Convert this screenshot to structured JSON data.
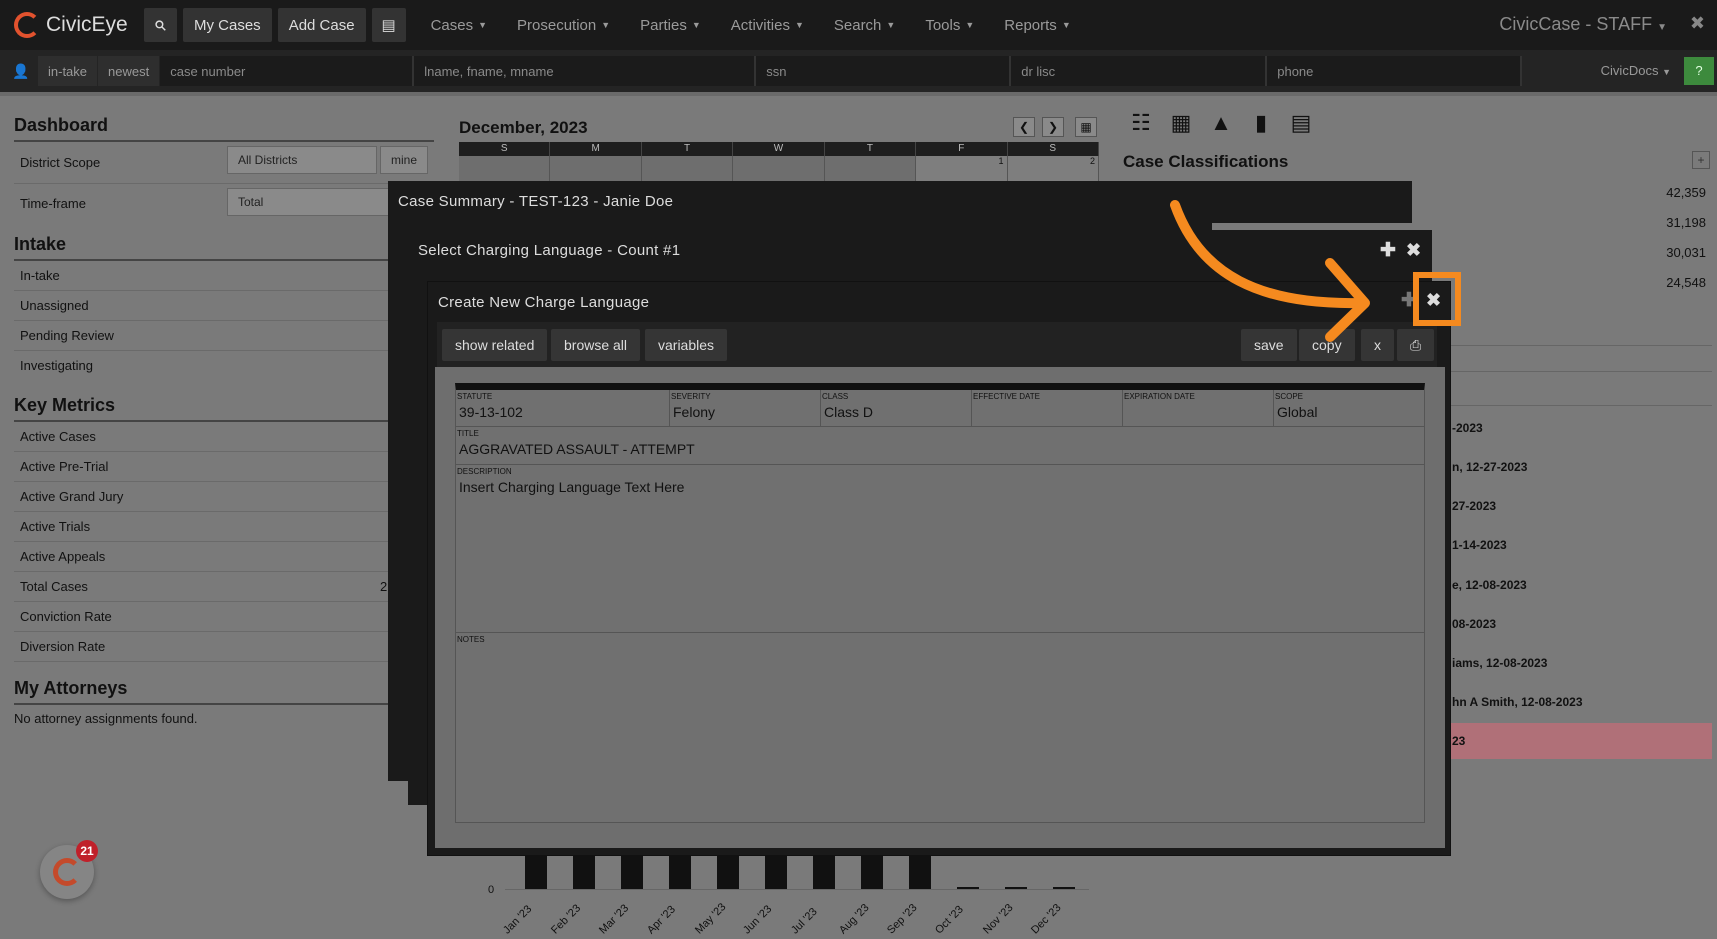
{
  "navbar": {
    "brand": "CivicEye",
    "my_cases": "My Cases",
    "add_case": "Add Case",
    "menus": [
      "Cases",
      "Prosecution",
      "Parties",
      "Activities",
      "Search",
      "Tools",
      "Reports"
    ],
    "app_title": "CivicCase - STAFF"
  },
  "searchbar": {
    "intake": "in-take",
    "newest": "newest",
    "case_number": "case number",
    "name": "lname, fname, mname",
    "ssn": "ssn",
    "drlisc": "dr lisc",
    "phone": "phone",
    "civicdocs": "CivicDocs",
    "help": "?"
  },
  "dashboard": {
    "title": "Dashboard",
    "district_scope_label": "District Scope",
    "district_scope_value": "All Districts",
    "mine": "mine",
    "timeframe_label": "Time-frame",
    "timeframe_value": "Total",
    "intake_title": "Intake",
    "intake_items": [
      "In-take",
      "Unassigned",
      "Pending Review",
      "Investigating"
    ],
    "metrics_title": "Key Metrics",
    "metrics_items": [
      "Active Cases",
      "Active Pre-Trial",
      "Active Grand Jury",
      "Active Trials",
      "Active Appeals",
      "Total Cases",
      "Conviction Rate",
      "Diversion Rate"
    ],
    "total_cases_partial": "2",
    "attorneys_title": "My Attorneys",
    "attorneys_empty": "No attorney assignments found."
  },
  "calendar": {
    "title": "December, 2023",
    "days": [
      "S",
      "M",
      "T",
      "W",
      "T",
      "F",
      "S"
    ],
    "first_row": [
      "",
      "",
      "",
      "",
      "",
      "1",
      "2"
    ]
  },
  "classifications": {
    "title": "Case Classifications",
    "values": [
      "42,359",
      "31,198",
      "30,031",
      "24,548"
    ]
  },
  "activity_items": [
    "-2023",
    "n, 12-27-2023",
    "27-2023",
    "1-14-2023",
    "e, 12-08-2023",
    "08-2023",
    "iams, 12-08-2023",
    "hn A Smith, 12-08-2023",
    "23"
  ],
  "chart_data": {
    "type": "bar",
    "categories": [
      "Jan '23",
      "Feb '23",
      "Mar '23",
      "Apr '23",
      "May '23",
      "Jun '23",
      "Jul '23",
      "Aug '23",
      "Sep '23",
      "Oct '23",
      "Nov '23",
      "Dec '23"
    ],
    "y_tick": "0"
  },
  "chat": {
    "badge": "21"
  },
  "modal_back": {
    "title": "Case Summary - TEST-123 - Janie Doe"
  },
  "modal_mid": {
    "title": "Select Charging Language - Count #1"
  },
  "modal_front": {
    "title": "Create New Charge Language",
    "buttons_left": [
      "show related",
      "browse all",
      "variables"
    ],
    "save": "save",
    "copy": "copy",
    "x": "x",
    "fields": {
      "statute_label": "STATUTE",
      "statute": "39-13-102",
      "severity_label": "SEVERITY",
      "severity": "Felony",
      "class_label": "CLASS",
      "class": "Class D",
      "effective_label": "EFFECTIVE DATE",
      "effective": "",
      "expiration_label": "EXPIRATION DATE",
      "expiration": "",
      "scope_label": "SCOPE",
      "scope": "Global",
      "title_label": "TITLE",
      "title": "AGGRAVATED ASSAULT - ATTEMPT",
      "description_label": "DESCRIPTION",
      "description": "Insert Charging Language Text Here",
      "notes_label": "NOTES",
      "notes": ""
    }
  },
  "colors": {
    "accent": "#f58a1f",
    "brand": "#e2522e"
  }
}
